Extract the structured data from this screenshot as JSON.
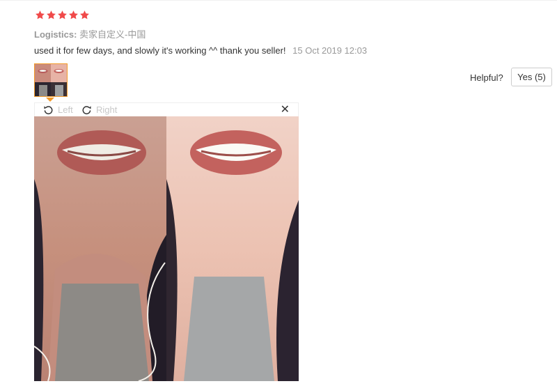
{
  "review": {
    "rating": 5,
    "rating_max": 5,
    "logistics_label": "Logistics:",
    "logistics_value": "卖家自定义-中国",
    "text": "used it for few days, and slowly it's working ^^ thank you seller!",
    "date": "15 Oct 2019 12:03"
  },
  "helpful": {
    "label": "Helpful?",
    "yes_button": "Yes (5)"
  },
  "viewer": {
    "rotate_left_label": "Left",
    "rotate_right_label": "Right",
    "close_glyph": "✕"
  },
  "colors": {
    "star": "#f04a4a",
    "thumb_border": "#f29a29"
  },
  "icons": [
    "star-icon",
    "rotate-left-icon",
    "rotate-right-icon",
    "close-icon"
  ]
}
